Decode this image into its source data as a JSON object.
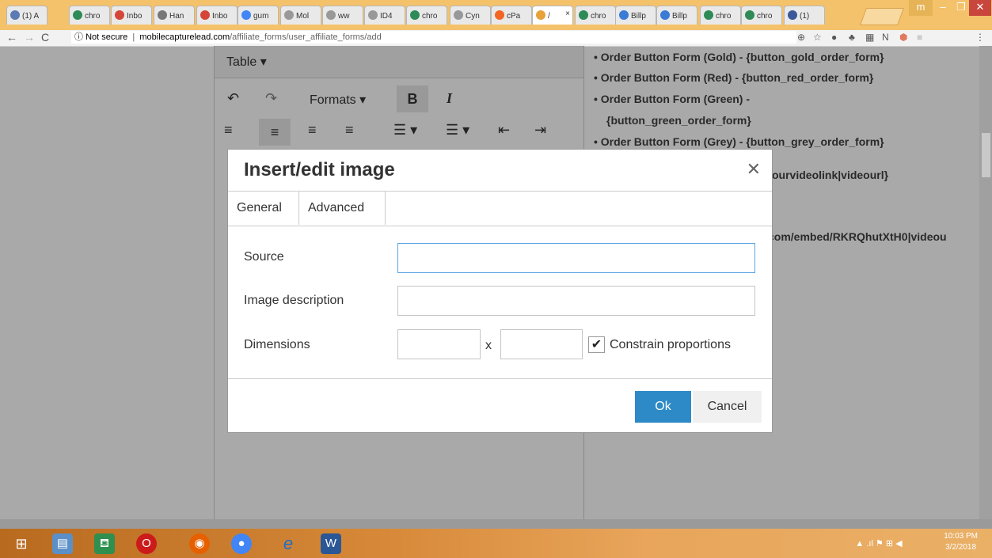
{
  "browser": {
    "tabs": [
      {
        "label": "(1) A",
        "icon": "page-icon",
        "color": "#5b7bb5"
      },
      {
        "label": "chro",
        "icon": "chrome-icon",
        "color": "#2e8b57"
      },
      {
        "label": "Inbo",
        "icon": "gmail-icon",
        "color": "#d44638"
      },
      {
        "label": "Han",
        "icon": "image-icon",
        "color": "#777777"
      },
      {
        "label": "Inbo",
        "icon": "gmail-icon",
        "color": "#d44638"
      },
      {
        "label": "gum",
        "icon": "google-icon",
        "color": "#4285f4"
      },
      {
        "label": "Mol",
        "icon": "page-icon",
        "color": "#999999"
      },
      {
        "label": "ww",
        "icon": "page-icon",
        "color": "#999999"
      },
      {
        "label": "ID4",
        "icon": "page-icon",
        "color": "#999999"
      },
      {
        "label": "chro",
        "icon": "chrome-icon",
        "color": "#2e8b57"
      },
      {
        "label": "Cyn",
        "icon": "page-icon",
        "color": "#999999"
      },
      {
        "label": "cPa",
        "icon": "cpanel-icon",
        "color": "#f26522"
      },
      {
        "label": "/",
        "icon": "page-icon",
        "color": "#e8a13b",
        "active": true
      },
      {
        "label": "chro",
        "icon": "chrome-icon",
        "color": "#2e8b57"
      },
      {
        "label": "Billp",
        "icon": "b-icon",
        "color": "#3a7bd5"
      },
      {
        "label": "Billp",
        "icon": "b-icon",
        "color": "#3a7bd5"
      },
      {
        "label": "chro",
        "icon": "chrome-icon",
        "color": "#2e8b57"
      },
      {
        "label": "chro",
        "icon": "chrome-icon",
        "color": "#2e8b57"
      },
      {
        "label": "(1)",
        "icon": "facebook-icon",
        "color": "#3b5998"
      }
    ],
    "url_secure_label": "Not secure",
    "url_host": "mobilecapturelead.com",
    "url_path": "/affiliate_forms/user_affiliate_forms/add",
    "profile_initial": "m"
  },
  "editor": {
    "menu_table": "Table ▾",
    "formats_label": "Formats ▾"
  },
  "right_content": [
    "• Order Button Form (Gold) - {button_gold_order_form}",
    "• Order Button Form (Red) - {button_red_order_form}",
    "• Order Button Form (Green) -",
    "{button_green_order_form}",
    "• Order Button Form (Grey) - {button_grey_order_form}",
    "ourvideolink|videourl}",
    "com/embed/RKRQhutXtH0|videou"
  ],
  "dialog": {
    "title": "Insert/edit image",
    "tabs": [
      "General",
      "Advanced"
    ],
    "source_label": "Source",
    "source_value": "",
    "description_label": "Image description",
    "description_value": "",
    "dimensions_label": "Dimensions",
    "dimensions_x": "x",
    "width_value": "",
    "height_value": "",
    "constrain_label": "Constrain proportions",
    "constrain_checked": true,
    "ok_label": "Ok",
    "cancel_label": "Cancel"
  },
  "taskbar": {
    "time": "10:03 PM",
    "date": "3/2/2018"
  }
}
